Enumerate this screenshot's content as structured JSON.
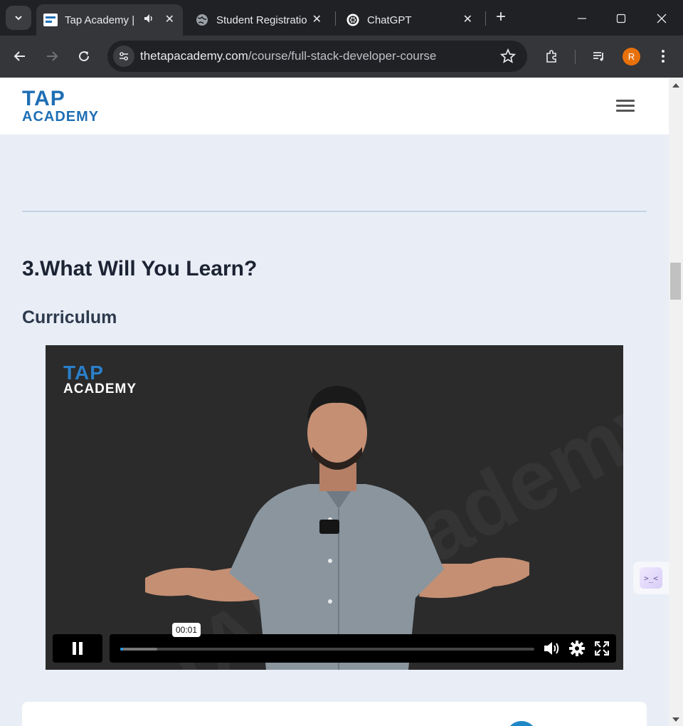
{
  "browser": {
    "tabs": [
      {
        "title": "Tap Academy |",
        "active": true,
        "audio": true
      },
      {
        "title": "Student Registratio",
        "active": false
      },
      {
        "title": "ChatGPT",
        "active": false
      }
    ],
    "url_host": "thetapacademy.com",
    "url_path": "/course/full-stack-developer-course",
    "profile_initial": "R"
  },
  "site": {
    "logo_top": "TAP",
    "logo_bottom": "ACADEMY"
  },
  "content": {
    "section_title": "3.What Will You Learn?",
    "subtitle": "Curriculum"
  },
  "video": {
    "logo_top": "TAP",
    "logo_bottom": "ACADEMY",
    "watermark": "TAP Academy",
    "current_time": "00:01",
    "played_fraction": 0.004,
    "buffered_fraction": 0.09
  },
  "widget": {
    "label": ">_<"
  },
  "colors": {
    "brand": "#1f6fb5",
    "progress": "#1e9be9",
    "page_bg": "#e9eef6"
  }
}
